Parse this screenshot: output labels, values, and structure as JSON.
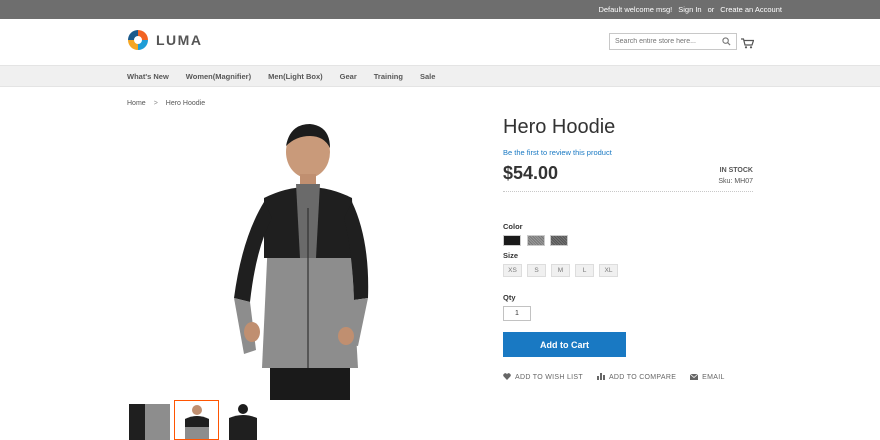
{
  "topbar": {
    "welcome": "Default welcome msg!",
    "signin": "Sign In",
    "or": "or",
    "create": "Create an Account"
  },
  "logo": {
    "text": "LUMA"
  },
  "search": {
    "placeholder": "Search entire store here..."
  },
  "nav": [
    "What's New",
    "Women(Magnifier)",
    "Men(Light Box)",
    "Gear",
    "Training",
    "Sale"
  ],
  "breadcrumb": {
    "home": "Home",
    "sep": ">",
    "current": "Hero Hoodie"
  },
  "product": {
    "title": "Hero Hoodie",
    "review": "Be the first to review this product",
    "price": "$54.00",
    "stock": "IN STOCK",
    "sku_label": "Sku:",
    "sku": "MH07",
    "color_label": "Color",
    "size_label": "Size",
    "sizes": [
      "XS",
      "S",
      "M",
      "L",
      "XL"
    ],
    "qty_label": "Qty",
    "qty": "1",
    "add_to_cart": "Add to Cart",
    "wishlist": "ADD TO WISH LIST",
    "compare": "ADD TO COMPARE",
    "email": "EMAIL"
  },
  "colors": {
    "accent": "#1979c3",
    "swatch1": "#1a1a1a",
    "swatch2": "#8a8a8a",
    "swatch3": "#5f5f5f"
  }
}
